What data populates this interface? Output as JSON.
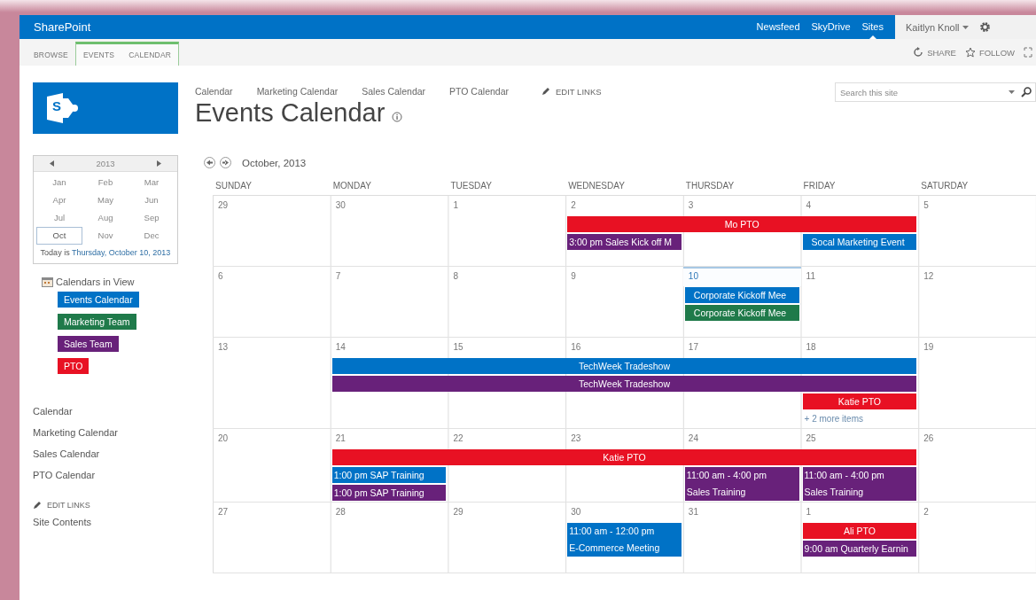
{
  "suite_bar": {
    "brand": "SharePoint",
    "links": [
      {
        "label": "Newsfeed",
        "selected": false
      },
      {
        "label": "SkyDrive",
        "selected": false
      },
      {
        "label": "Sites",
        "selected": true
      }
    ],
    "user": "Kaitlyn Knoll"
  },
  "ribbon": {
    "tabs": [
      {
        "label": "BROWSE",
        "contextual": false
      },
      {
        "label": "EVENTS",
        "contextual": true
      },
      {
        "label": "CALENDAR",
        "contextual": true
      }
    ],
    "actions": [
      {
        "kind": "share",
        "label": "SHARE"
      },
      {
        "kind": "follow",
        "label": "FOLLOW"
      }
    ]
  },
  "sidebar": {
    "logo": {
      "letter": "S"
    },
    "date_picker": {
      "year": "2013",
      "months": [
        {
          "label": "Jan",
          "selected": false
        },
        {
          "label": "Feb",
          "selected": false
        },
        {
          "label": "Mar",
          "selected": false
        },
        {
          "label": "Apr",
          "selected": false
        },
        {
          "label": "May",
          "selected": false
        },
        {
          "label": "Jun",
          "selected": false
        },
        {
          "label": "Jul",
          "selected": false
        },
        {
          "label": "Aug",
          "selected": false
        },
        {
          "label": "Sep",
          "selected": false
        },
        {
          "label": "Oct",
          "selected": true
        },
        {
          "label": "Nov",
          "selected": false
        },
        {
          "label": "Dec",
          "selected": false
        }
      ],
      "today_prefix": "Today is",
      "today_link": "Thursday, October 10, 2013"
    },
    "calendars_heading": "Calendars in View",
    "calendars": [
      {
        "label": "Events Calendar",
        "color": "#0072c6"
      },
      {
        "label": "Marketing Team",
        "color": "#1f7a4a"
      },
      {
        "label": "Sales Team",
        "color": "#68217a"
      },
      {
        "label": "PTO",
        "color": "#e81123"
      }
    ],
    "nav": [
      "Calendar",
      "Marketing Calendar",
      "Sales Calendar",
      "PTO Calendar"
    ],
    "edit_links": "EDIT LINKS",
    "site_contents": "Site Contents"
  },
  "top_nav": {
    "links": [
      "Calendar",
      "Marketing Calendar",
      "Sales Calendar",
      "PTO Calendar"
    ],
    "edit_links": "EDIT LINKS"
  },
  "search": {
    "placeholder": "Search this site"
  },
  "page_title": "Events Calendar",
  "calendar": {
    "month": "October, 2013",
    "weekdays": [
      "SUNDAY",
      "MONDAY",
      "TUESDAY",
      "WEDNESDAY",
      "THURSDAY",
      "FRIDAY",
      "SATURDAY"
    ],
    "weeks": [
      {
        "days": [
          {
            "label": "29",
            "today": false
          },
          {
            "label": "30",
            "today": false
          },
          {
            "label": "1",
            "today": false
          },
          {
            "label": "2",
            "today": false,
            "events": [
              {
                "kind": "allday",
                "title": "Mo PTO",
                "color": "#e81123"
              },
              {
                "kind": "timed",
                "time": "3:00 pm",
                "title": "Sales Kick off M",
                "color": "#68217a"
              }
            ]
          },
          {
            "label": "3",
            "today": false,
            "events": [
              {
                "kind": "continued"
              }
            ]
          },
          {
            "label": "4",
            "today": false,
            "events": [
              {
                "kind": "continued"
              },
              {
                "kind": "item",
                "title": "Socal Marketing Event",
                "color": "#0072c6"
              }
            ]
          },
          {
            "label": "5",
            "today": false
          }
        ]
      },
      {
        "days": [
          {
            "label": "6",
            "today": false
          },
          {
            "label": "7",
            "today": false
          },
          {
            "label": "8",
            "today": false
          },
          {
            "label": "9",
            "today": false
          },
          {
            "label": "10",
            "today": true,
            "events": [
              {
                "kind": "item",
                "title": "Corporate Kickoff Mee",
                "color": "#0072c6"
              },
              {
                "kind": "item",
                "title": "Corporate Kickoff Mee",
                "color": "#1f7a4a"
              }
            ]
          },
          {
            "label": "11",
            "today": false
          },
          {
            "label": "12",
            "today": false
          }
        ]
      },
      {
        "days": [
          {
            "label": "13",
            "today": false
          },
          {
            "label": "14",
            "today": false,
            "events": [
              {
                "kind": "allday",
                "title": "TechWeek Tradeshow",
                "color": "#0072c6"
              },
              {
                "kind": "allday",
                "title": "TechWeek Tradeshow",
                "color": "#68217a"
              }
            ]
          },
          {
            "label": "15",
            "today": false,
            "events": [
              {
                "kind": "continued"
              },
              {
                "kind": "continued"
              }
            ]
          },
          {
            "label": "16",
            "today": false,
            "events": [
              {
                "kind": "continued"
              },
              {
                "kind": "continued"
              }
            ]
          },
          {
            "label": "17",
            "today": false,
            "events": [
              {
                "kind": "continued"
              },
              {
                "kind": "continued"
              }
            ]
          },
          {
            "label": "18",
            "today": false,
            "events": [
              {
                "kind": "continued"
              },
              {
                "kind": "continued"
              },
              {
                "kind": "allday",
                "title": "Katie PTO",
                "color": "#e81123"
              },
              {
                "kind": "more",
                "title": "+ 2 more items"
              }
            ]
          },
          {
            "label": "19",
            "today": false
          }
        ]
      },
      {
        "days": [
          {
            "label": "20",
            "today": false
          },
          {
            "label": "21",
            "today": false,
            "events": [
              {
                "kind": "allday",
                "title": "Katie PTO",
                "color": "#e81123"
              },
              {
                "kind": "timed",
                "time": "1:00 pm",
                "title": "SAP Training",
                "color": "#0072c6"
              },
              {
                "kind": "timed",
                "time": "1:00 pm",
                "title": "SAP Training",
                "color": "#68217a"
              }
            ]
          },
          {
            "label": "22",
            "today": false,
            "events": [
              {
                "kind": "continued"
              }
            ]
          },
          {
            "label": "23",
            "today": false,
            "events": [
              {
                "kind": "continued"
              }
            ]
          },
          {
            "label": "24",
            "today": false,
            "events": [
              {
                "kind": "continued"
              },
              {
                "kind": "block",
                "time": "11:00 am - 4:00 pm",
                "title": "Sales Training",
                "color": "#68217a"
              }
            ]
          },
          {
            "label": "25",
            "today": false,
            "events": [
              {
                "kind": "continued"
              },
              {
                "kind": "block",
                "time": "11:00 am - 4:00 pm",
                "title": "Sales Training",
                "color": "#68217a"
              }
            ]
          },
          {
            "label": "26",
            "today": false
          }
        ]
      },
      {
        "days": [
          {
            "label": "27",
            "today": false
          },
          {
            "label": "28",
            "today": false
          },
          {
            "label": "29",
            "today": false
          },
          {
            "label": "30",
            "today": false,
            "events": [
              {
                "kind": "block",
                "time": "11:00 am - 12:00 pm",
                "title": "E-Commerce Meeting",
                "color": "#0072c6"
              }
            ]
          },
          {
            "label": "31",
            "today": false
          },
          {
            "label": "1",
            "today": false,
            "events": [
              {
                "kind": "allday",
                "title": "Ali PTO",
                "color": "#e81123"
              },
              {
                "kind": "timed",
                "time": "9:00 am",
                "title": "Quarterly Earnin",
                "color": "#68217a"
              }
            ]
          },
          {
            "label": "2",
            "today": false
          }
        ]
      }
    ]
  }
}
